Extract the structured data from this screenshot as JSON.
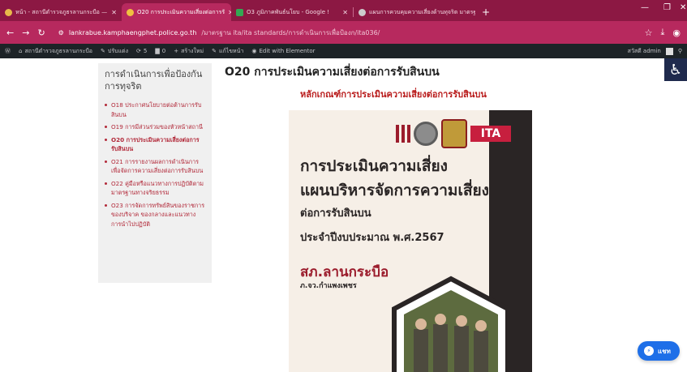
{
  "browser": {
    "tabs": [
      {
        "label": "หน้า - สถานีตำรวจภูธรลานกระบือ —",
        "active": false
      },
      {
        "label": "O20 การประเมินความเสี่ยงต่อการรั",
        "active": true
      },
      {
        "label": "O3 ภูมิภาคพันธ์นโยบ - Google !",
        "active": false
      },
      {
        "label": "แผนการควบคุมความเสี่ยงด้านทุจริต มาตรฐ",
        "active": false
      }
    ],
    "url_host": "lankrabue.kamphaengphet.police.go.th",
    "url_path": "/มาตรฐาน ita/ita standards/การดำเนินการเพื่อป้องก/ita036/"
  },
  "adminbar": {
    "site": "สถานีตำรวจภูธรลานกระบือ",
    "customize": "ปรับแต่ง",
    "updates": "5",
    "comments": "0",
    "new": "สร้างใหม่",
    "edit": "แก้ไขหน้า",
    "elementor": "Edit with Elementor",
    "greeting": "สวัสดี admin"
  },
  "sidebar": {
    "title": "การดำเนินการเพื่อป้องกันการทุจริต",
    "items": [
      {
        "label": "O18 ประกาศนโยบายต่อต้านการรับสินบน"
      },
      {
        "label": "O19 การมีส่วนร่วมของหัวหน้าสถานี"
      },
      {
        "label": "O20 การประเมินความเสี่ยงต่อการรับสินบน"
      },
      {
        "label": "O21 การรายงานผลการดำเนินการเพื่อจัดการความเสี่ยงต่อการรับสินบน"
      },
      {
        "label": "O22 คู่มือหรือแนวทางการปฏิบัติตามมาตรฐานทางจริยธรรม"
      },
      {
        "label": "O23 การจัดการทรัพย์สินของราชการของบริจาค ของกลางและแนวทางการนำไปปฏิบัติ"
      }
    ]
  },
  "main": {
    "title": "O20 การประเมินความเสี่ยงต่อการรับสินบน",
    "subheading": "หลักเกณฑ์การประเมินความเสี่ยงต่อการรับสินบน"
  },
  "poster": {
    "ita": "ITA",
    "line1": "การประเมินความเสี่ยง",
    "line2": "แผนบริหารจัดการความเสี่ยง",
    "line3": "ต่อการรับสินบน",
    "line4": "ประจำปีงบประมาณ พ.ศ.2567",
    "station": "สภ.ลานกระบือ",
    "province": "ภ.จว.กำแพงเพชร"
  },
  "chat": {
    "label": "แชท"
  },
  "colors": {
    "tabbar": "#8c1843",
    "toolbar": "#b7295e",
    "link": "#b22a3a",
    "accent_red": "#b91c1c"
  }
}
